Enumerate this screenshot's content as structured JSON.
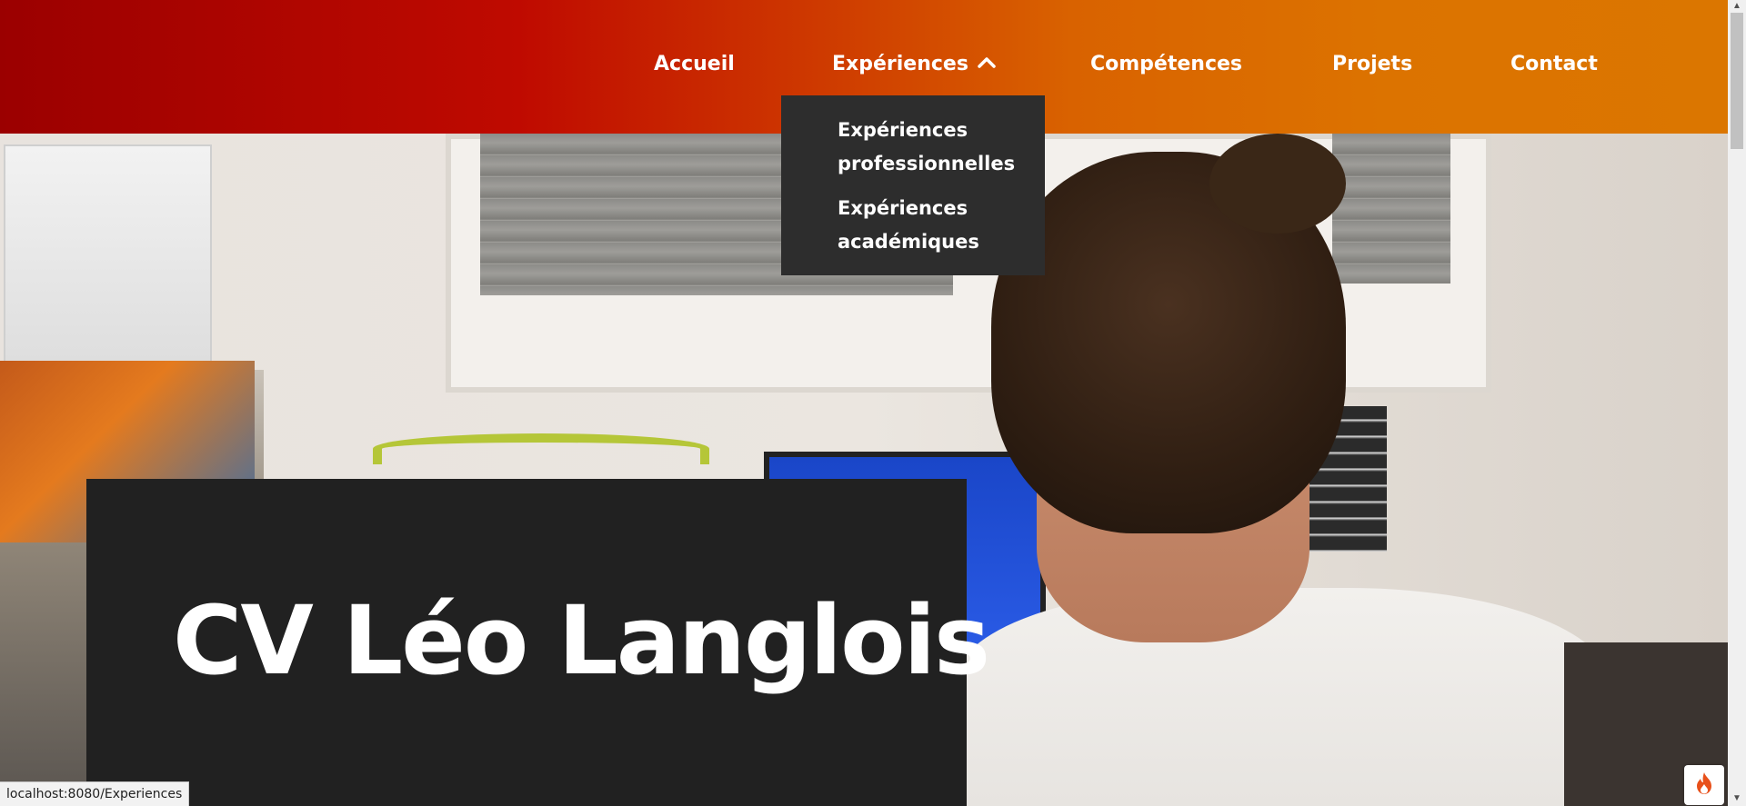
{
  "nav": {
    "items": [
      {
        "label": "Accueil"
      },
      {
        "label": "Expériences"
      },
      {
        "label": "Compétences"
      },
      {
        "label": "Projets"
      },
      {
        "label": "Contact"
      }
    ],
    "expanded_item": "Expériences",
    "dropdown": {
      "items": [
        {
          "label": "Expériences professionnelles"
        },
        {
          "label": "Expériences académiques"
        }
      ]
    }
  },
  "hero": {
    "title": "CV Léo Langlois"
  },
  "status_bar": {
    "url": "localhost:8080/Experiences"
  },
  "icons": {
    "dropdown_chevron": "chevron-up-icon",
    "widget": "flame-icon"
  },
  "colors": {
    "header_gradient_start": "#9b0000",
    "header_gradient_end": "#db7600",
    "dropdown_bg": "#2d2d2d",
    "title_card_bg": "#212121",
    "text": "#ffffff",
    "flame": "#e8501a"
  }
}
